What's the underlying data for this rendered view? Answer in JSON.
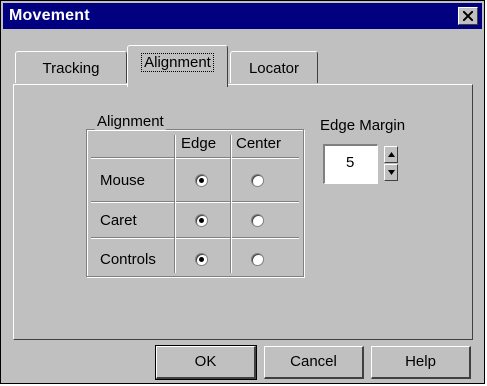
{
  "window": {
    "title": "Movement"
  },
  "tabs": [
    {
      "label": "Tracking"
    },
    {
      "label": "Alignment",
      "active": true
    },
    {
      "label": "Locator"
    }
  ],
  "alignment_group": {
    "label": "Alignment",
    "columns": [
      "Edge",
      "Center"
    ],
    "rows": [
      {
        "label": "Mouse",
        "selected": "Edge"
      },
      {
        "label": "Caret",
        "selected": "Edge"
      },
      {
        "label": "Controls",
        "selected": "Edge"
      }
    ]
  },
  "edge_margin": {
    "label": "Edge Margin",
    "value": "5"
  },
  "buttons": {
    "ok": "OK",
    "cancel": "Cancel",
    "help": "Help"
  },
  "colors": {
    "titlebar": "#000080",
    "face": "#c0c0c0"
  },
  "icons": {
    "close": "close-icon",
    "spin_up": "arrow-up-icon",
    "spin_down": "arrow-down-icon"
  }
}
